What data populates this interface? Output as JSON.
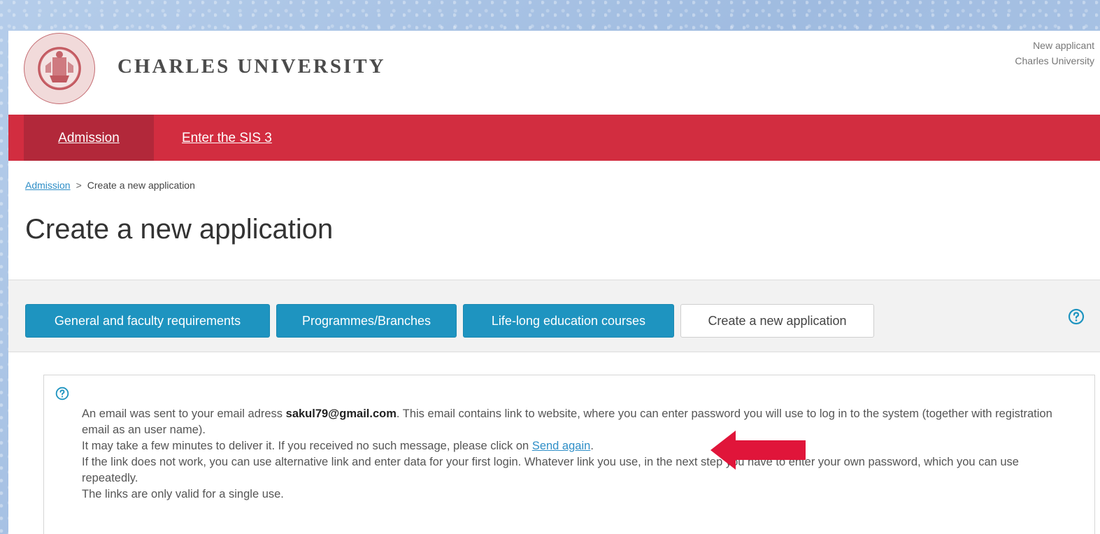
{
  "header": {
    "university_name": "CHARLES UNIVERSITY",
    "user_line1": "New applicant",
    "user_line2": "Charles University"
  },
  "nav": {
    "items": [
      {
        "label": "Admission"
      },
      {
        "label": "Enter the SIS 3"
      }
    ]
  },
  "breadcrumb": {
    "root": "Admission",
    "separator": ">",
    "current": "Create a new application"
  },
  "page": {
    "title": "Create a new application"
  },
  "tabs": [
    {
      "label": "General and faculty requirements"
    },
    {
      "label": "Programmes/Branches"
    },
    {
      "label": "Life-long education courses"
    },
    {
      "label": "Create a new application"
    }
  ],
  "info": {
    "line1_prefix": "An email was sent to your email adress ",
    "email": "sakul79@gmail.com",
    "line1_suffix": ". This email contains link to website, where you can enter password you will use to log in to the system (together with registration email as an user name).",
    "line2_prefix": "It may take a few minutes to deliver it. If you received no such message, please click on ",
    "send_again": "Send again",
    "line2_suffix": ".",
    "line3": "If the link does not work, you can use alternative link and enter data for your first login. Whatever link you use, in the next step you have to enter your own password, which you can use repeatedly.",
    "line4": "The links are only valid for a single use."
  },
  "icons": {
    "logo": "university-seal-icon",
    "help": "question-circle-icon",
    "info": "question-circle-icon",
    "annotation": "arrow-left-icon"
  },
  "colors": {
    "nav_bg": "#d22d40",
    "nav_active": "#b2283a",
    "tab_blue": "#1e94c0",
    "link": "#2e8ec7",
    "arrow": "#e0153a"
  }
}
